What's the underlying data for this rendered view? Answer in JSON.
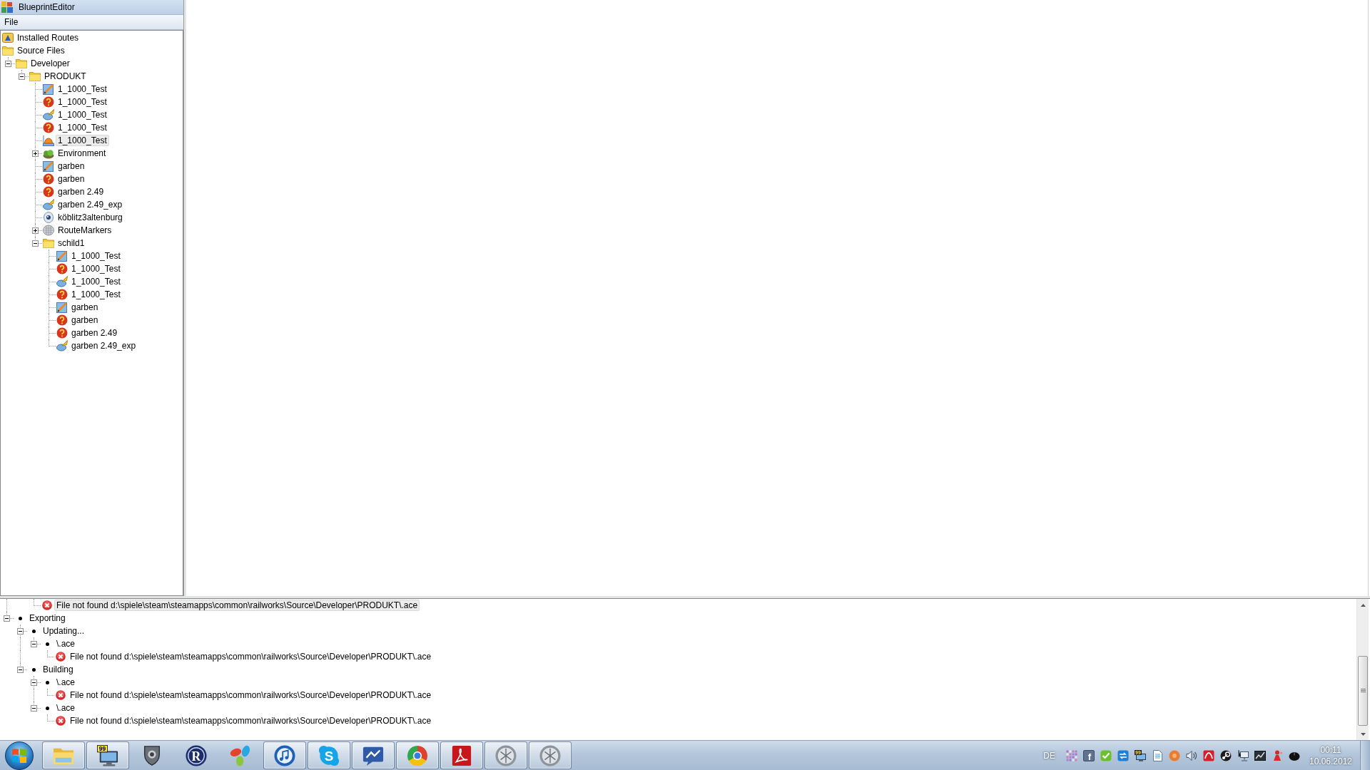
{
  "window": {
    "title": "BlueprintEditor"
  },
  "menu": [
    "File"
  ],
  "tree": {
    "items": [
      {
        "label": "Installed Routes",
        "kind": "routes",
        "selected": false
      },
      {
        "label": "Source Files",
        "kind": "folder",
        "selected": false,
        "children": [
          {
            "label": "Developer",
            "kind": "folder",
            "selected": false,
            "expanded": true,
            "children": [
              {
                "label": "PRODUKT",
                "kind": "folder",
                "selected": false,
                "expanded": true,
                "children": [
                  {
                    "label": "1_1000_Test",
                    "kind": "drawing",
                    "selected": false
                  },
                  {
                    "label": "1_1000_Test",
                    "kind": "missing",
                    "selected": false
                  },
                  {
                    "label": "1_1000_Test",
                    "kind": "model",
                    "selected": false
                  },
                  {
                    "label": "1_1000_Test",
                    "kind": "missing",
                    "selected": false
                  },
                  {
                    "label": "1_1000_Test",
                    "kind": "scenery",
                    "selected": true
                  },
                  {
                    "label": "Environment",
                    "kind": "environment",
                    "selected": false,
                    "expanded": false
                  },
                  {
                    "label": "garben",
                    "kind": "drawing",
                    "selected": false
                  },
                  {
                    "label": "garben",
                    "kind": "missing",
                    "selected": false
                  },
                  {
                    "label": "garben 2.49",
                    "kind": "missing",
                    "selected": false
                  },
                  {
                    "label": "garben 2.49_exp",
                    "kind": "model",
                    "selected": false
                  },
                  {
                    "label": "köblitz3altenburg",
                    "kind": "viewpoint",
                    "selected": false
                  },
                  {
                    "label": "RouteMarkers",
                    "kind": "markers",
                    "selected": false,
                    "expanded": false
                  },
                  {
                    "label": "schild1",
                    "kind": "folder",
                    "selected": false,
                    "expanded": true,
                    "children": [
                      {
                        "label": "1_1000_Test",
                        "kind": "drawing",
                        "selected": false
                      },
                      {
                        "label": "1_1000_Test",
                        "kind": "missing",
                        "selected": false
                      },
                      {
                        "label": "1_1000_Test",
                        "kind": "model",
                        "selected": false
                      },
                      {
                        "label": "1_1000_Test",
                        "kind": "missing",
                        "selected": false
                      },
                      {
                        "label": "garben",
                        "kind": "drawing",
                        "selected": false
                      },
                      {
                        "label": "garben",
                        "kind": "missing",
                        "selected": false
                      },
                      {
                        "label": "garben 2.49",
                        "kind": "missing",
                        "selected": false
                      },
                      {
                        "label": "garben 2.49_exp",
                        "kind": "model",
                        "selected": false
                      }
                    ]
                  }
                ]
              }
            ]
          }
        ]
      }
    ]
  },
  "log": {
    "items": [
      {
        "children": [
          {
            "children": [
              {
                "text": "File not found d:\\spiele\\steam\\steamapps\\common\\railworks\\Source\\Developer\\PRODUKT\\.ace",
                "kind": "error",
                "selected": true
              }
            ]
          }
        ]
      },
      {
        "text": "Exporting",
        "kind": "bullet",
        "selected": false,
        "expanded": true,
        "children": [
          {
            "text": "Updating...",
            "kind": "bullet",
            "selected": false,
            "expanded": true,
            "children": [
              {
                "text": "\\.ace",
                "kind": "bullet",
                "selected": false,
                "expanded": true,
                "children": [
                  {
                    "text": "File not found d:\\spiele\\steam\\steamapps\\common\\railworks\\Source\\Developer\\PRODUKT\\.ace",
                    "kind": "error",
                    "selected": false
                  }
                ]
              }
            ]
          },
          {
            "text": "Building",
            "kind": "bullet",
            "selected": false,
            "expanded": true,
            "children": [
              {
                "text": "\\.ace",
                "kind": "bullet",
                "selected": false,
                "expanded": true,
                "children": [
                  {
                    "text": "File not found d:\\spiele\\steam\\steamapps\\common\\railworks\\Source\\Developer\\PRODUKT\\.ace",
                    "kind": "error",
                    "selected": false
                  }
                ]
              },
              {
                "text": "\\.ace",
                "kind": "bullet",
                "selected": false,
                "expanded": true,
                "children": [
                  {
                    "text": "File not found d:\\spiele\\steam\\steamapps\\common\\railworks\\Source\\Developer\\PRODUKT\\.ace",
                    "kind": "error",
                    "selected": false
                  }
                ]
              }
            ]
          }
        ]
      }
    ]
  },
  "taskbar": {
    "buttons": [
      {
        "kind": "folder",
        "running": true
      },
      {
        "kind": "monitor",
        "running": true,
        "badge": "99"
      },
      {
        "kind": "shield",
        "running": false
      },
      {
        "kind": "letterdisc",
        "running": false,
        "badge": "R"
      },
      {
        "kind": "petals",
        "running": false
      },
      {
        "kind": "note",
        "running": true
      },
      {
        "kind": "bubble",
        "running": true,
        "badge": "S"
      },
      {
        "kind": "zigzag",
        "running": true
      },
      {
        "kind": "ring",
        "running": true
      },
      {
        "kind": "swirl",
        "running": true
      },
      {
        "kind": "disc",
        "running": true
      },
      {
        "kind": "disc",
        "running": true
      }
    ],
    "tray": {
      "language": "DE",
      "icons": [
        {
          "kind": "dots"
        },
        {
          "kind": "letter",
          "badge": "f"
        },
        {
          "kind": "check"
        },
        {
          "kind": "arrows"
        },
        {
          "kind": "monitor",
          "badge": "99"
        },
        {
          "kind": "page"
        },
        {
          "kind": "ball"
        },
        {
          "kind": "speaker"
        },
        {
          "kind": "umbrella"
        },
        {
          "kind": "gear"
        },
        {
          "kind": "network"
        },
        {
          "kind": "chart"
        },
        {
          "kind": "figure"
        },
        {
          "kind": "mouse"
        }
      ],
      "time": "00:11",
      "date": "10.06.2012"
    }
  }
}
